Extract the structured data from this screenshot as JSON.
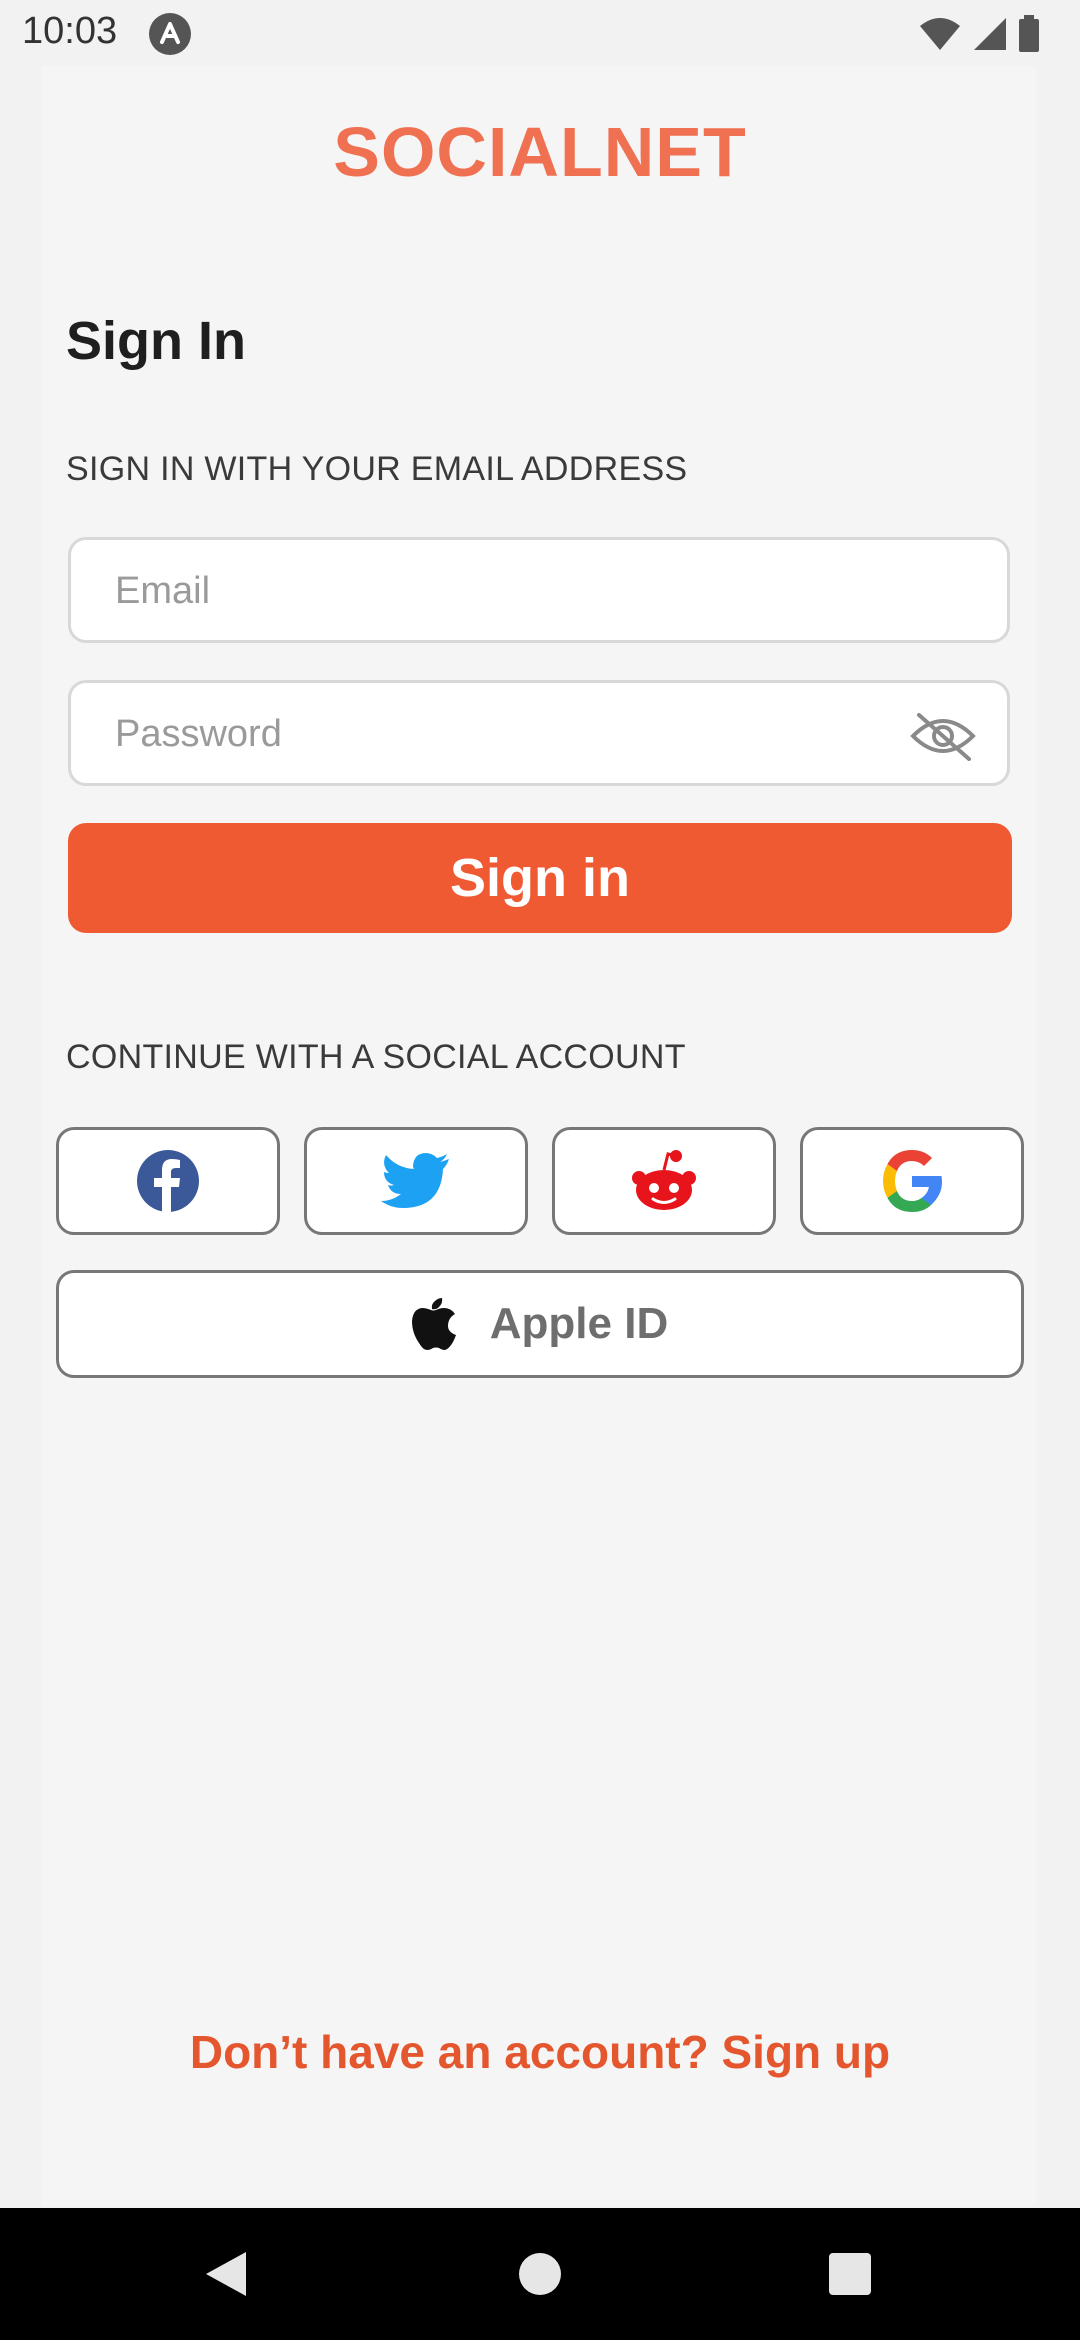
{
  "status_bar": {
    "time": "10:03",
    "icons": [
      "app-notification-icon",
      "wifi-icon",
      "cell-signal-icon",
      "battery-icon"
    ]
  },
  "brand": {
    "logo_text": "SOCIALNET",
    "accent_color": "#ef5a32"
  },
  "signin": {
    "title": "Sign In",
    "email_section_label": "SIGN IN WITH YOUR EMAIL ADDRESS",
    "email_placeholder": "Email",
    "email_value": "",
    "password_placeholder": "Password",
    "password_value": "",
    "password_toggle_icon": "eye-off-icon",
    "submit_label": "Sign in"
  },
  "social": {
    "section_label": "CONTINUE WITH A SOCIAL ACCOUNT",
    "providers": [
      {
        "name": "Facebook",
        "icon": "facebook-icon",
        "color": "#3b5998"
      },
      {
        "name": "Twitter",
        "icon": "twitter-icon",
        "color": "#1da1f2"
      },
      {
        "name": "Reddit",
        "icon": "reddit-icon",
        "color": "#e8141c"
      },
      {
        "name": "Google",
        "icon": "google-icon",
        "color": "#4285f4"
      }
    ],
    "apple_label": "Apple ID",
    "apple_icon": "apple-icon"
  },
  "footer": {
    "signup_text": "Don’t have an account? Sign up"
  },
  "nav": {
    "icons": [
      "back-icon",
      "home-icon",
      "recents-icon"
    ]
  }
}
